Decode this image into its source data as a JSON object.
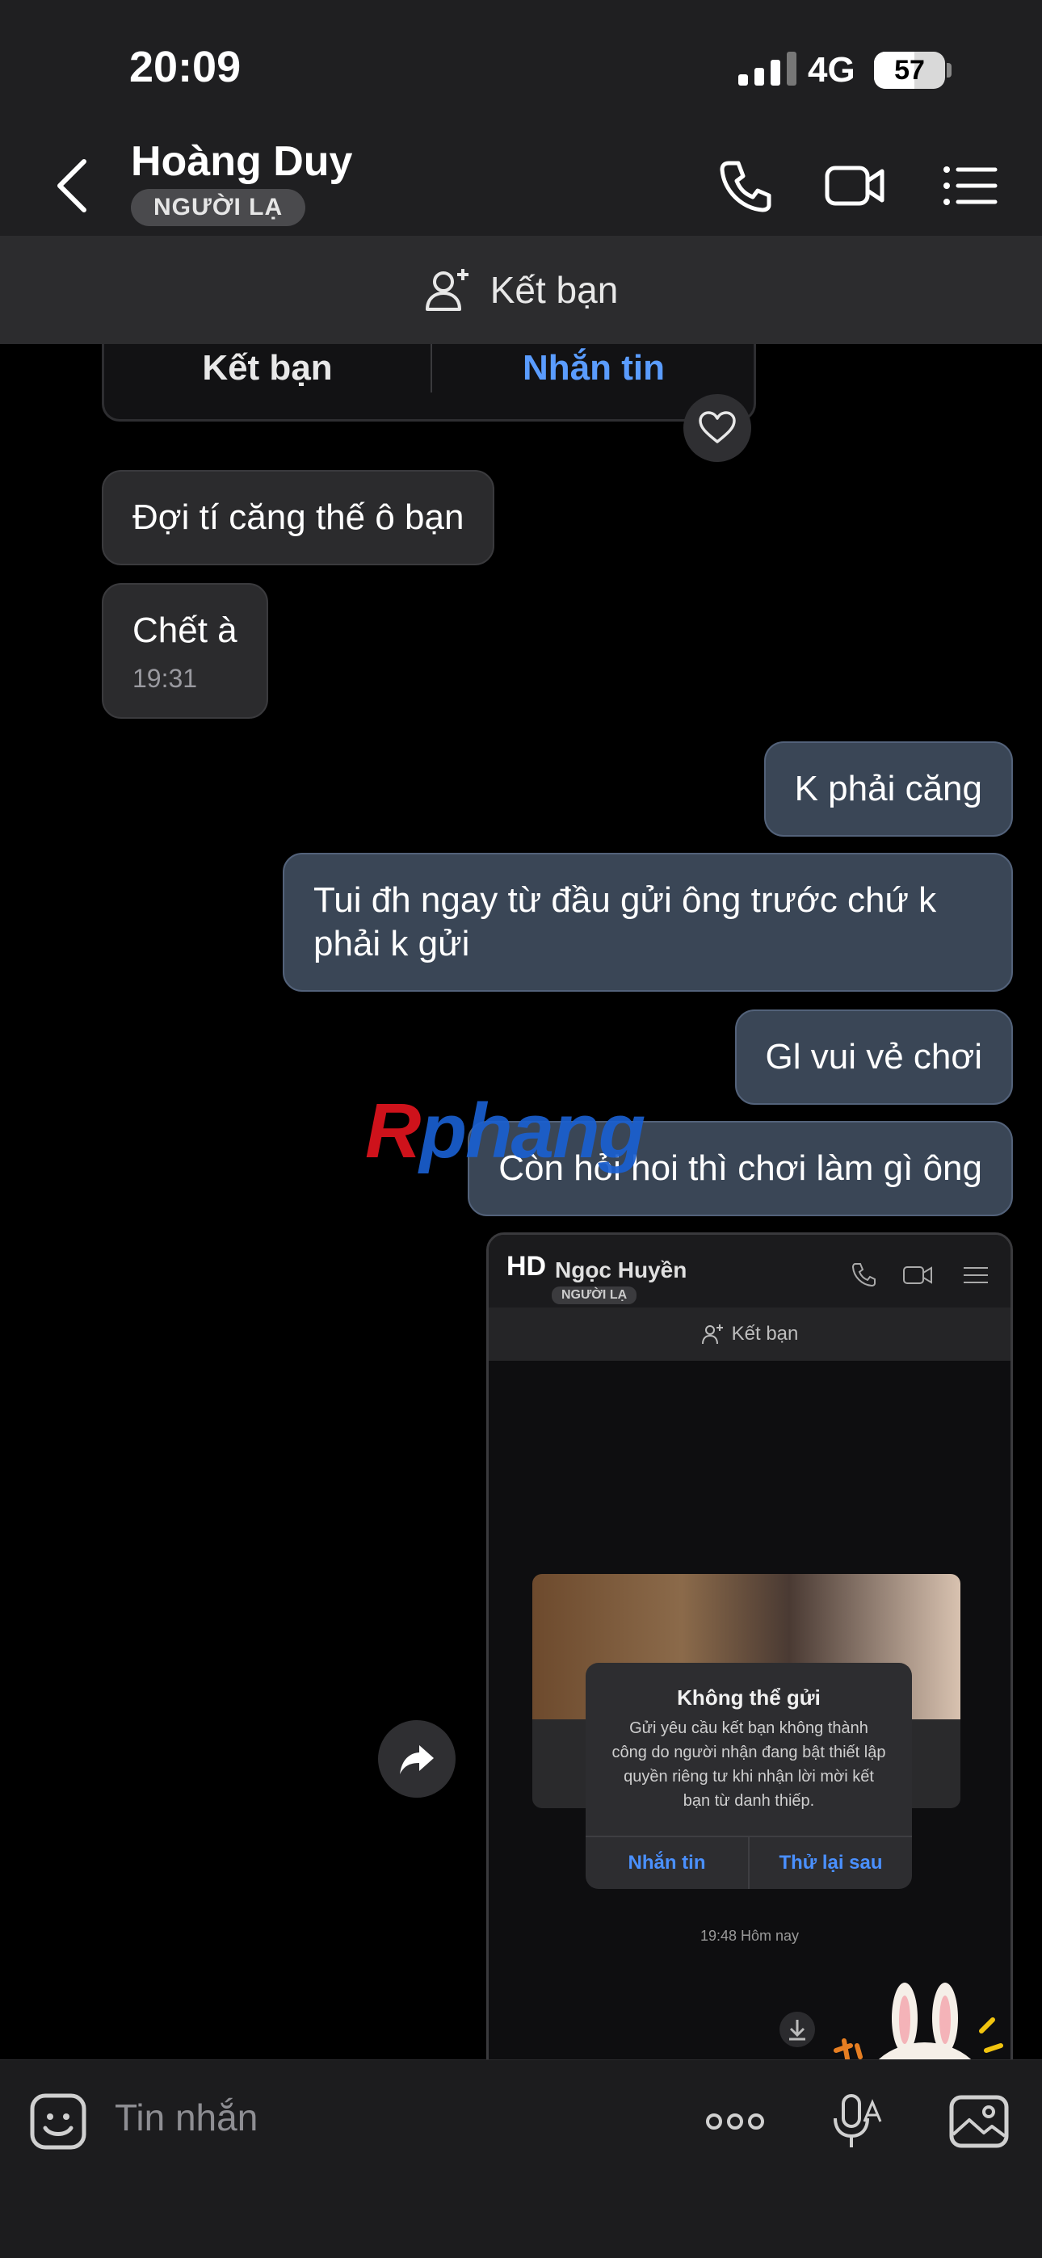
{
  "status_bar": {
    "time": "20:09",
    "network": "4G",
    "battery": "57",
    "battery_level": 0.57
  },
  "header": {
    "contact_name": "Hoàng Duy",
    "badge": "NGƯỜI LẠ"
  },
  "add_friend_bar": {
    "label": "Kết bạn"
  },
  "card": {
    "add_friend_label": "Kết bạn",
    "message_label": "Nhắn tin"
  },
  "messages": [
    {
      "side": "in",
      "text": "Đợi tí căng thế ô bạn"
    },
    {
      "side": "in",
      "text": "Chết à",
      "time": "19:31"
    },
    {
      "side": "out",
      "text": "K phải căng"
    },
    {
      "side": "out",
      "text": "Tui đh ngay từ đầu gửi ông trước chứ k phải k gửi"
    },
    {
      "side": "out",
      "text": "Gl vui vẻ chơi"
    },
    {
      "side": "out",
      "text": "Còn hỏi hoi thì chơi làm gì ông"
    }
  ],
  "watermark": {
    "first": "R",
    "rest": "phang"
  },
  "screenshot": {
    "hd_label": "HD",
    "contact_name": "Ngọc Huyền",
    "badge": "NGƯỜI LẠ",
    "add_friend_label": "Kết bạn",
    "dialog_title": "Không thể gửi",
    "dialog_body": "Gửi yêu cầu kết bạn không thành công do người nhận đang bật thiết lập quyền riêng tư khi nhận lời mời kết bạn từ danh thiếp.",
    "dialog_primary": "Nhắn tin",
    "dialog_secondary": "Thử lại sau",
    "timestamp": "19:48 Hôm nay"
  },
  "input": {
    "placeholder": "Tin nhắn"
  }
}
